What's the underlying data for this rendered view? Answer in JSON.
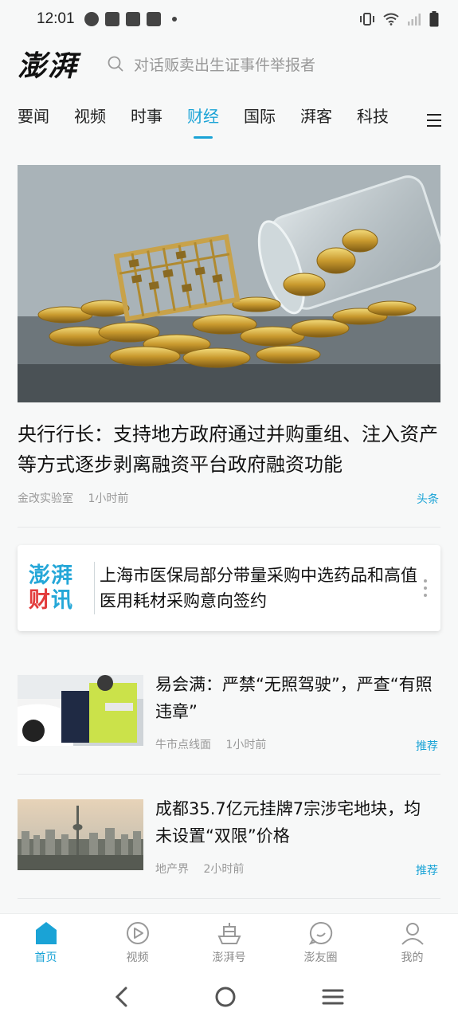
{
  "status_bar": {
    "time": "12:01"
  },
  "header": {
    "logo": "澎湃",
    "search_placeholder": "对话贩卖出生证事件举报者"
  },
  "nav": {
    "tabs": [
      "要闻",
      "视频",
      "时事",
      "财经",
      "国际",
      "湃客",
      "科技"
    ],
    "active_index": 3
  },
  "hero": {
    "title": "央行行长：支持地方政府通过并购重组、注入资产等方式逐步剥离融资平台政府融资功能",
    "source": "金改实验室",
    "time": "1小时前",
    "tag": "头条"
  },
  "promo": {
    "logo_line1": "澎湃",
    "logo_line2_a": "财",
    "logo_line2_b": "讯",
    "text": "上海市医保局部分带量采购中选药品和高值医用耗材采购意向签约"
  },
  "items": [
    {
      "title": "易会满：严禁“无照驾驶”，严查“有照违章”",
      "source": "牛市点线面",
      "time": "1小时前",
      "tag": "推荐"
    },
    {
      "title": "成都35.7亿元挂牌7宗涉宅地块，均未设置“双限”价格",
      "source": "地产界",
      "time": "2小时前",
      "tag": "推荐"
    }
  ],
  "bottom_tabs": [
    {
      "label": "首页",
      "icon": "home-icon"
    },
    {
      "label": "视频",
      "icon": "play-icon"
    },
    {
      "label": "澎湃号",
      "icon": "ship-icon"
    },
    {
      "label": "澎友圈",
      "icon": "chat-icon"
    },
    {
      "label": "我的",
      "icon": "user-icon"
    }
  ],
  "colors": {
    "accent": "#1aa3d6",
    "red": "#e23b3b"
  }
}
